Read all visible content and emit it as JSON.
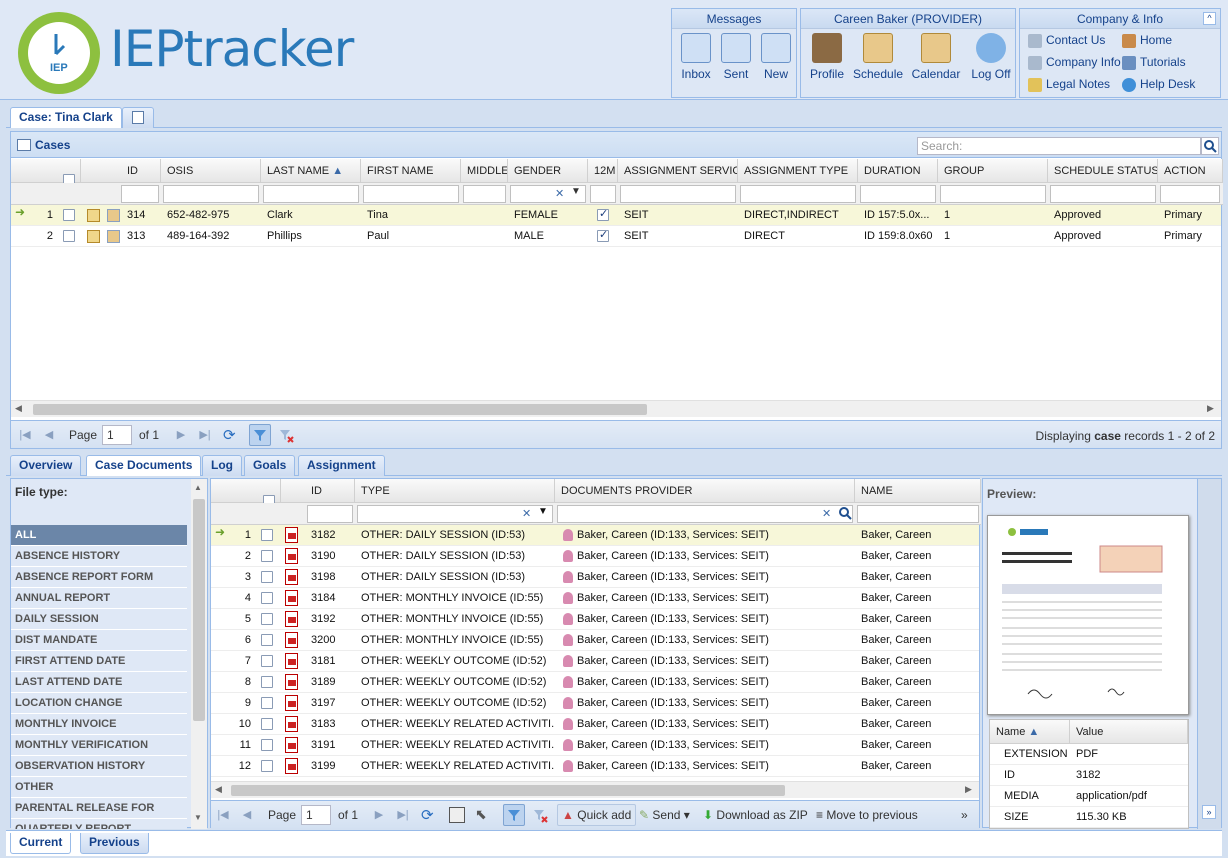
{
  "app": {
    "logo_text": "IEPtracker",
    "logo_badge": "IEP"
  },
  "toolbar": {
    "messages": {
      "title": "Messages",
      "buttons": [
        "Inbox",
        "Sent",
        "New"
      ]
    },
    "user": {
      "title": "Careen Baker (PROVIDER)",
      "buttons": [
        "Profile",
        "Schedule",
        "Calendar",
        "Log Off"
      ]
    },
    "company": {
      "title": "Company & Info",
      "links": [
        "Contact Us",
        "Home",
        "Company Info",
        "Tutorials",
        "Legal Notes",
        "Help Desk"
      ]
    }
  },
  "case_tab": {
    "label": "Case: Tina Clark"
  },
  "cases": {
    "title": "Cases",
    "search_placeholder": "Search:",
    "columns": [
      "ID",
      "OSIS",
      "LAST NAME",
      "FIRST NAME",
      "MIDDLE",
      "GENDER",
      "12M",
      "ASSIGNMENT SERVICE",
      "ASSIGNMENT TYPE",
      "DURATION",
      "GROUP",
      "SCHEDULE STATUS",
      "ACTION"
    ],
    "rows": [
      {
        "n": "1",
        "id": "314",
        "osis": "652-482-975",
        "last": "Clark",
        "first": "Tina",
        "middle": "",
        "gender": "FEMALE",
        "m12": true,
        "service": "SEIT",
        "type": "DIRECT,INDIRECT",
        "duration": "ID 157:5.0x...",
        "group": "1",
        "status": "Approved",
        "action": "Primary"
      },
      {
        "n": "2",
        "id": "313",
        "osis": "489-164-392",
        "last": "Phillips",
        "first": "Paul",
        "middle": "",
        "gender": "MALE",
        "m12": true,
        "service": "SEIT",
        "type": "DIRECT",
        "duration": "ID 159:8.0x60",
        "group": "1",
        "status": "Approved",
        "action": "Primary"
      }
    ],
    "pager": {
      "page_label": "Page",
      "page": "1",
      "of": "of 1",
      "display_prefix": "Displaying ",
      "display_bold": "case",
      "display_suffix": " records 1 - 2 of 2"
    }
  },
  "bottom_tabs": [
    "Overview",
    "Case Documents",
    "Log",
    "Goals",
    "Assignment"
  ],
  "file_types": {
    "title": "File type:",
    "items": [
      "ALL",
      "ABSENCE HISTORY",
      "ABSENCE REPORT FORM",
      "ANNUAL REPORT",
      "DAILY SESSION",
      "DIST MANDATE",
      "FIRST ATTEND DATE",
      "LAST ATTEND DATE",
      "LOCATION CHANGE",
      "MONTHLY INVOICE",
      "MONTHLY VERIFICATION",
      "OBSERVATION HISTORY",
      "OTHER",
      "PARENTAL RELEASE FOR",
      "QUARTERLY REPORT"
    ]
  },
  "documents": {
    "columns": [
      "ID",
      "TYPE",
      "DOCUMENTS PROVIDER",
      "NAME"
    ],
    "rows": [
      {
        "n": "1",
        "id": "3182",
        "type": "OTHER: DAILY SESSION (ID:53)",
        "provider": "Baker, Careen (ID:133, Services: SEIT)",
        "name": "Baker, Careen"
      },
      {
        "n": "2",
        "id": "3190",
        "type": "OTHER: DAILY SESSION (ID:53)",
        "provider": "Baker, Careen (ID:133, Services: SEIT)",
        "name": "Baker, Careen"
      },
      {
        "n": "3",
        "id": "3198",
        "type": "OTHER: DAILY SESSION (ID:53)",
        "provider": "Baker, Careen (ID:133, Services: SEIT)",
        "name": "Baker, Careen"
      },
      {
        "n": "4",
        "id": "3184",
        "type": "OTHER: MONTHLY INVOICE (ID:55)",
        "provider": "Baker, Careen (ID:133, Services: SEIT)",
        "name": "Baker, Careen"
      },
      {
        "n": "5",
        "id": "3192",
        "type": "OTHER: MONTHLY INVOICE (ID:55)",
        "provider": "Baker, Careen (ID:133, Services: SEIT)",
        "name": "Baker, Careen"
      },
      {
        "n": "6",
        "id": "3200",
        "type": "OTHER: MONTHLY INVOICE (ID:55)",
        "provider": "Baker, Careen (ID:133, Services: SEIT)",
        "name": "Baker, Careen"
      },
      {
        "n": "7",
        "id": "3181",
        "type": "OTHER: WEEKLY OUTCOME (ID:52)",
        "provider": "Baker, Careen (ID:133, Services: SEIT)",
        "name": "Baker, Careen"
      },
      {
        "n": "8",
        "id": "3189",
        "type": "OTHER: WEEKLY OUTCOME (ID:52)",
        "provider": "Baker, Careen (ID:133, Services: SEIT)",
        "name": "Baker, Careen"
      },
      {
        "n": "9",
        "id": "3197",
        "type": "OTHER: WEEKLY OUTCOME (ID:52)",
        "provider": "Baker, Careen (ID:133, Services: SEIT)",
        "name": "Baker, Careen"
      },
      {
        "n": "10",
        "id": "3183",
        "type": "OTHER: WEEKLY RELATED ACTIVITI...",
        "provider": "Baker, Careen (ID:133, Services: SEIT)",
        "name": "Baker, Careen"
      },
      {
        "n": "11",
        "id": "3191",
        "type": "OTHER: WEEKLY RELATED ACTIVITI...",
        "provider": "Baker, Careen (ID:133, Services: SEIT)",
        "name": "Baker, Careen"
      },
      {
        "n": "12",
        "id": "3199",
        "type": "OTHER: WEEKLY RELATED ACTIVITI...",
        "provider": "Baker, Careen (ID:133, Services: SEIT)",
        "name": "Baker, Careen"
      }
    ],
    "pager": {
      "page_label": "Page",
      "page": "1",
      "of": "of 1",
      "quick_add": "Quick add",
      "send": "Send",
      "download": "Download as ZIP",
      "move_prev": "Move to previous"
    }
  },
  "preview": {
    "title": "Preview:",
    "columns": [
      "Name",
      "Value"
    ],
    "props": [
      {
        "name": "EXTENSION",
        "value": "PDF"
      },
      {
        "name": "ID",
        "value": "3182"
      },
      {
        "name": "MEDIA",
        "value": "application/pdf"
      },
      {
        "name": "SIZE",
        "value": "115.30 KB"
      }
    ]
  },
  "footer_tabs": [
    "Current",
    "Previous"
  ]
}
